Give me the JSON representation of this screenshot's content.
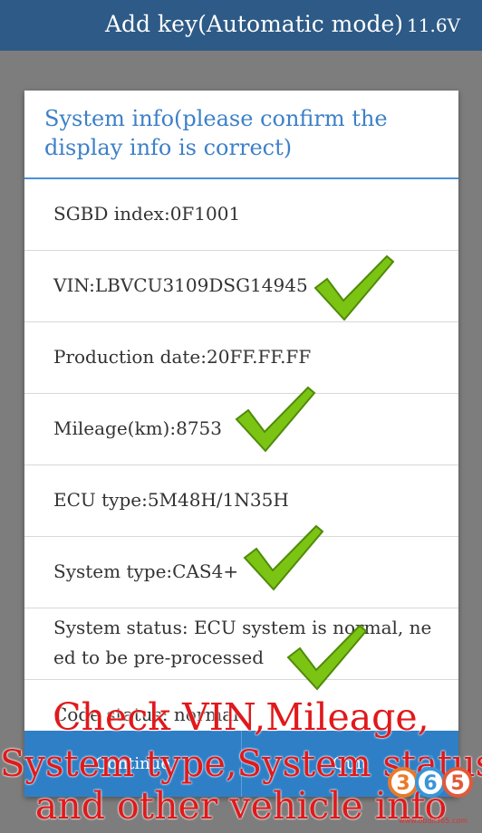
{
  "header": {
    "title": "Add key(Automatic mode)",
    "voltage": "11.6V"
  },
  "dialog": {
    "title": "System info(please confirm the display info is correct)",
    "rows": [
      {
        "label": "SGBD index:0F1001"
      },
      {
        "label": "VIN:LBVCU3109DSG14945"
      },
      {
        "label": "Production date:20FF.FF.FF"
      },
      {
        "label": "Mileage(km):8753"
      },
      {
        "label": "ECU type:5M48H/1N35H"
      },
      {
        "label": "System type:CAS4+"
      },
      {
        "label": "System status: ECU system is normal, need to be pre-processed"
      },
      {
        "label": "Code status: normal"
      }
    ],
    "buttons": {
      "continue": "Continue",
      "quit": "Quit"
    }
  },
  "overlay": {
    "line1": "Check VIN,Mileage,",
    "line2": "System type,System status",
    "line3": "and other vehicle info"
  },
  "watermark": {
    "logo_digits": "365",
    "url": "www.obdii365.com"
  },
  "colors": {
    "header": "#2d5a86",
    "accent": "#3d80c8",
    "button": "#2f7fc7",
    "annotation": "#e0191b",
    "check": "#7cc414"
  }
}
